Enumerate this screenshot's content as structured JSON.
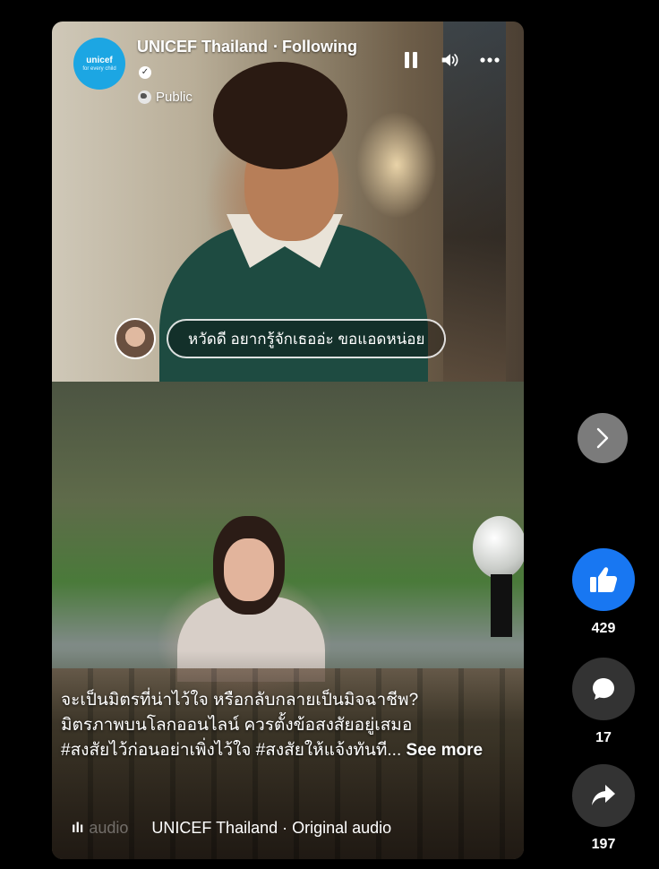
{
  "header": {
    "logo_line1": "unicef",
    "logo_line2": "for every child",
    "page_name": "UNICEF Thailand",
    "follow_status": "Following",
    "privacy": "Public"
  },
  "comment_preview": {
    "text": "หวัดดี อยากรู้จักเธออ่ะ ขอแอดหน่อย"
  },
  "caption": {
    "line1": "จะเป็นมิตรที่น่าไว้ใจ หรือกลับกลายเป็นมิจฉาชีพ?",
    "line2": "มิตรภาพบนโลกออนไลน์ ควรตั้งข้อสงสัยอยู่เสมอ",
    "line3": "#สงสัยไว้ก่อนอย่าเพิ่งไว้ใจ #สงสัยให้แจ้งทันที...",
    "see_more": "See more"
  },
  "audio": {
    "faded_label": "audio",
    "source": "UNICEF Thailand · Original audio"
  },
  "actions": {
    "likes": "429",
    "comments": "17",
    "shares": "197"
  },
  "icons": {
    "next": "chevron-right-icon",
    "like": "thumbs-up-icon",
    "comment": "comment-bubble-icon",
    "share": "share-arrow-icon",
    "pause": "pause-icon",
    "volume": "volume-icon",
    "more": "more-options-icon"
  },
  "colors": {
    "like_blue": "#1877f2",
    "logo_blue": "#1ca6e3",
    "rail_dark": "#333333",
    "next_gray": "#7b7b7b"
  }
}
